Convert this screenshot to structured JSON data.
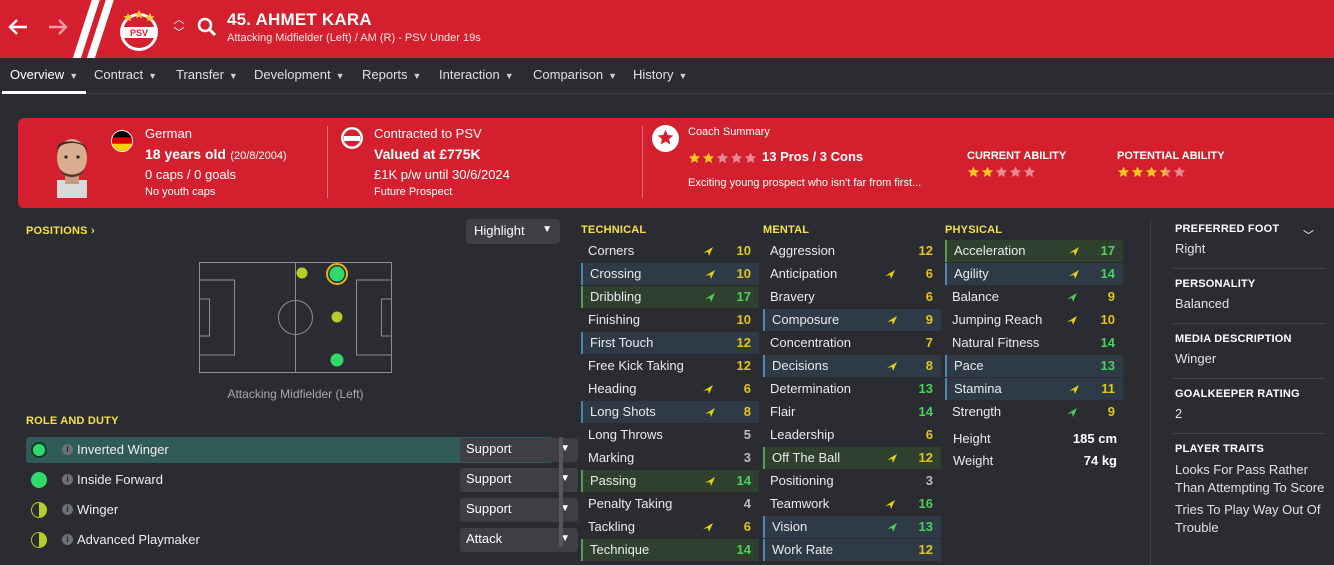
{
  "header": {
    "title": "45. AHMET KARA",
    "subtitle": "Attacking Midfielder (Left) / AM (R) - PSV Under 19s",
    "back_icon": "arrow-left-icon",
    "forward_icon": "arrow-right-icon",
    "club_badge_text": "PSV",
    "colors": {
      "brand": "#d4202e",
      "background": "#2a2c31"
    }
  },
  "tabs": [
    {
      "label": "Overview",
      "active": true
    },
    {
      "label": "Contract"
    },
    {
      "label": "Transfer"
    },
    {
      "label": "Development"
    },
    {
      "label": "Reports"
    },
    {
      "label": "Interaction"
    },
    {
      "label": "Comparison"
    },
    {
      "label": "History"
    }
  ],
  "banner": {
    "nationality": "German",
    "age": "18 years old",
    "dob": "(20/8/2004)",
    "caps": "0 caps / 0 goals",
    "youth_caps": "No youth caps",
    "contract_label": "Contracted to PSV",
    "value": "Valued at £775K",
    "wage": "£1K p/w until 30/6/2024",
    "prospect": "Future Prospect",
    "coach_title": "Coach Summary",
    "coach_rating": "13 Pros / 3 Cons",
    "coach_stars": 2,
    "coach_text": "Exciting young prospect who isn't far from first...",
    "current_ability_label": "CURRENT ABILITY",
    "current_ability_stars": 2,
    "potential_ability_label": "POTENTIAL ABILITY",
    "potential_ability_stars": 3.5
  },
  "positions": {
    "label": "POSITIONS ›",
    "highlight": "Highlight",
    "caption": "Attacking Midfielder (Left)"
  },
  "roles": {
    "label": "ROLE AND DUTY",
    "items": [
      {
        "name": "Inverted Winger",
        "duty": "Support",
        "selected": true
      },
      {
        "name": "Inside Forward",
        "duty": "Support"
      },
      {
        "name": "Winger",
        "duty": "Support"
      },
      {
        "name": "Advanced Playmaker",
        "duty": "Attack"
      }
    ]
  },
  "technical": {
    "label": "TECHNICAL",
    "rows": [
      {
        "name": "Corners",
        "value": "10",
        "arrow": "up"
      },
      {
        "name": "Crossing",
        "value": "10",
        "arrow": "up",
        "hl": "h"
      },
      {
        "name": "Dribbling",
        "value": "17",
        "arrow": "up-g",
        "hl": "hg"
      },
      {
        "name": "Finishing",
        "value": "10",
        "arrow": ""
      },
      {
        "name": "First Touch",
        "value": "12",
        "arrow": "",
        "hl": "h"
      },
      {
        "name": "Free Kick Taking",
        "value": "12",
        "arrow": ""
      },
      {
        "name": "Heading",
        "value": "6",
        "arrow": "up"
      },
      {
        "name": "Long Shots",
        "value": "8",
        "arrow": "up",
        "hl": "h"
      },
      {
        "name": "Long Throws",
        "value": "5",
        "arrow": ""
      },
      {
        "name": "Marking",
        "value": "3",
        "arrow": ""
      },
      {
        "name": "Passing",
        "value": "14",
        "arrow": "up",
        "hl": "hg"
      },
      {
        "name": "Penalty Taking",
        "value": "4",
        "arrow": ""
      },
      {
        "name": "Tackling",
        "value": "6",
        "arrow": "up"
      },
      {
        "name": "Technique",
        "value": "14",
        "arrow": "",
        "hl": "hg"
      }
    ]
  },
  "mental": {
    "label": "MENTAL",
    "rows": [
      {
        "name": "Aggression",
        "value": "12",
        "arrow": ""
      },
      {
        "name": "Anticipation",
        "value": "6",
        "arrow": "up"
      },
      {
        "name": "Bravery",
        "value": "6",
        "arrow": ""
      },
      {
        "name": "Composure",
        "value": "9",
        "arrow": "up",
        "hl": "h"
      },
      {
        "name": "Concentration",
        "value": "7",
        "arrow": ""
      },
      {
        "name": "Decisions",
        "value": "8",
        "arrow": "up",
        "hl": "h"
      },
      {
        "name": "Determination",
        "value": "13",
        "arrow": ""
      },
      {
        "name": "Flair",
        "value": "14",
        "arrow": ""
      },
      {
        "name": "Leadership",
        "value": "6",
        "arrow": ""
      },
      {
        "name": "Off The Ball",
        "value": "12",
        "arrow": "up",
        "hl": "hg"
      },
      {
        "name": "Positioning",
        "value": "3",
        "arrow": ""
      },
      {
        "name": "Teamwork",
        "value": "16",
        "arrow": "up"
      },
      {
        "name": "Vision",
        "value": "13",
        "arrow": "up-g",
        "hl": "h"
      },
      {
        "name": "Work Rate",
        "value": "12",
        "arrow": "",
        "hl": "h"
      }
    ]
  },
  "physical": {
    "label": "PHYSICAL",
    "rows": [
      {
        "name": "Acceleration",
        "value": "17",
        "arrow": "up",
        "hl": "hg"
      },
      {
        "name": "Agility",
        "value": "14",
        "arrow": "up",
        "hl": "h"
      },
      {
        "name": "Balance",
        "value": "9",
        "arrow": "up-g"
      },
      {
        "name": "Jumping Reach",
        "value": "10",
        "arrow": "up"
      },
      {
        "name": "Natural Fitness",
        "value": "14",
        "arrow": ""
      },
      {
        "name": "Pace",
        "value": "13",
        "arrow": "",
        "hl": "h"
      },
      {
        "name": "Stamina",
        "value": "11",
        "arrow": "up",
        "hl": "h"
      },
      {
        "name": "Strength",
        "value": "9",
        "arrow": "up-g"
      }
    ],
    "height_label": "Height",
    "height": "185 cm",
    "weight_label": "Weight",
    "weight": "74 kg"
  },
  "side": {
    "foot_label": "PREFERRED FOOT",
    "foot": "Right",
    "personality_label": "PERSONALITY",
    "personality": "Balanced",
    "media_label": "MEDIA DESCRIPTION",
    "media": "Winger",
    "gk_label": "GOALKEEPER RATING",
    "gk": "2",
    "traits_label": "PLAYER TRAITS",
    "traits": [
      "Looks For Pass Rather Than Attempting To Score",
      "Tries To Play Way Out Of Trouble"
    ]
  }
}
